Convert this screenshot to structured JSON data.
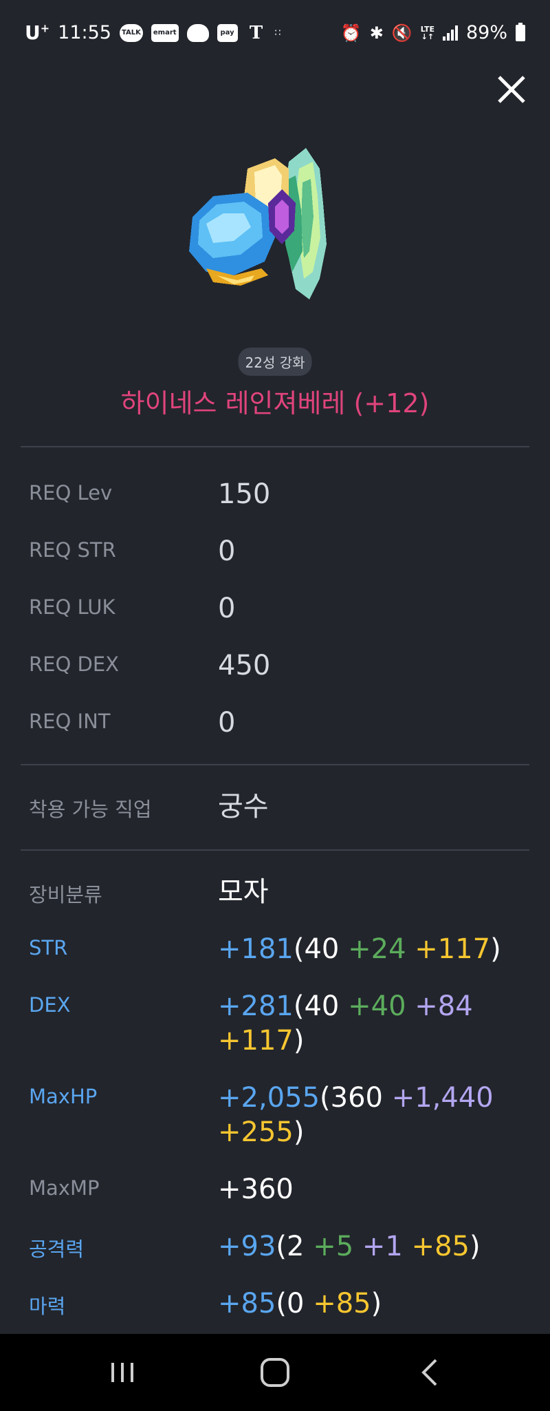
{
  "status_bar": {
    "carrier": "U",
    "carrier_sup": "+",
    "time": "11:55",
    "app_icons": [
      "TALK",
      "emart",
      "",
      "pay",
      "T"
    ],
    "battery": "89%"
  },
  "item": {
    "star_badge": "22성 강화",
    "name": "하이네스 레인져베레 (+12)"
  },
  "requirements": [
    {
      "label": "REQ Lev",
      "value": "150"
    },
    {
      "label": "REQ STR",
      "value": "0"
    },
    {
      "label": "REQ LUK",
      "value": "0"
    },
    {
      "label": "REQ DEX",
      "value": "450"
    },
    {
      "label": "REQ INT",
      "value": "0"
    }
  ],
  "job": {
    "label": "착용 가능 직업",
    "value": "궁수"
  },
  "category": {
    "label": "장비분류",
    "value": "모자"
  },
  "stats": {
    "str": {
      "label": "STR",
      "total": "+181",
      "open": "(",
      "base": "40",
      "scroll": "+24",
      "star": "+117",
      "close": ")"
    },
    "dex": {
      "label": "DEX",
      "total": "+281",
      "open": "(",
      "base": "40",
      "scroll": "+40",
      "flame": "+84",
      "star": "+117",
      "close": ")"
    },
    "maxhp": {
      "label": "MaxHP",
      "total": "+2,055",
      "open": "(",
      "base": "360",
      "flame": "+1,440",
      "star": "+255",
      "close": ")"
    },
    "maxmp": {
      "label": "MaxMP",
      "value": "+360"
    },
    "att": {
      "label": "공격력",
      "total": "+93",
      "open": "(",
      "base": "2",
      "scroll": "+5",
      "flame": "+1",
      "star": "+85",
      "close": ")"
    },
    "matt": {
      "label": "마력",
      "total": "+85",
      "open": "(",
      "base": "0",
      "star": "+85",
      "close": ")"
    }
  },
  "colors": {
    "background": "#22252c",
    "item_name": "#e0447c",
    "stat_total": "#5aa6f0",
    "scroll_bonus": "#5cac5c",
    "flame_bonus": "#b3a6f0",
    "star_bonus": "#f7c630"
  },
  "icons": {
    "close": "close-icon",
    "nav": [
      "recent-apps-icon",
      "home-icon",
      "back-icon"
    ]
  }
}
